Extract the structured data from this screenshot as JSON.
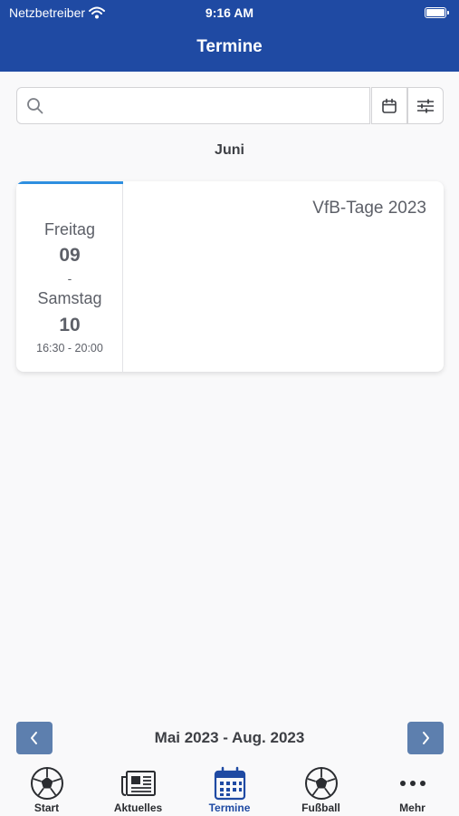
{
  "status_bar": {
    "carrier": "Netzbetreiber",
    "time": "9:16 AM"
  },
  "header": {
    "title": "Termine"
  },
  "search": {
    "placeholder": "",
    "value": ""
  },
  "month_heading": "Juni",
  "events": [
    {
      "day_start": "Freitag",
      "date_start": "09",
      "separator": "-",
      "day_end": "Samstag",
      "date_end": "10",
      "time_range": "16:30 - 20:00",
      "title": "VfB-Tage 2023"
    }
  ],
  "pagination": {
    "range_label": "Mai 2023 - Aug. 2023"
  },
  "tabs": [
    {
      "label": "Start",
      "icon": "soccer-ball-icon",
      "active": false
    },
    {
      "label": "Aktuelles",
      "icon": "newspaper-icon",
      "active": false
    },
    {
      "label": "Termine",
      "icon": "calendar-icon",
      "active": true
    },
    {
      "label": "Fußball",
      "icon": "soccer-ball-icon",
      "active": false
    },
    {
      "label": "Mehr",
      "icon": "more-dots-icon",
      "active": false
    }
  ],
  "colors": {
    "header_bg": "#1f4aa3",
    "accent": "#2e8fe0",
    "nav_button": "#5d7fae",
    "active_tab": "#1f4aa3"
  }
}
